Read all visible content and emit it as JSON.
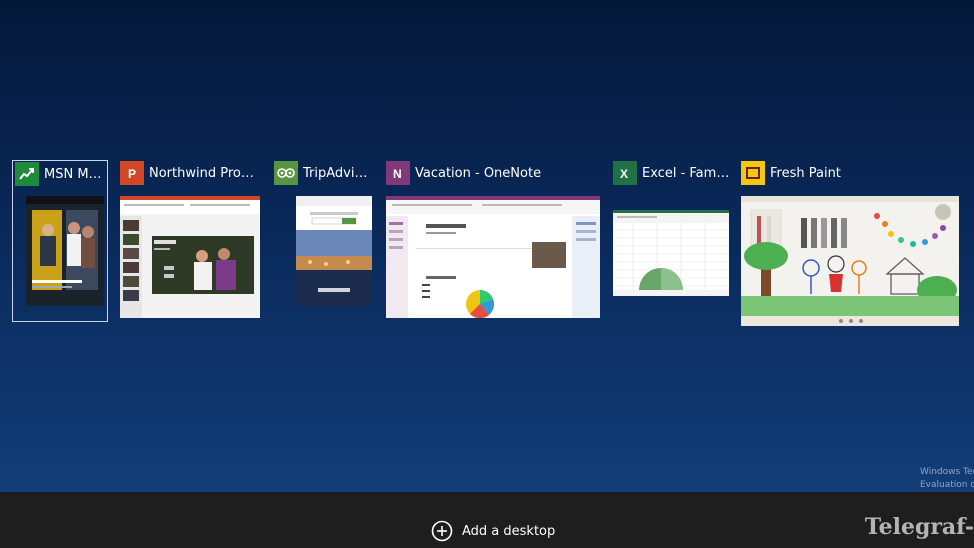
{
  "windows": [
    {
      "title": "MSN Mon...",
      "icon": "msn-money-icon",
      "icon_color": "#1e8a3c"
    },
    {
      "title": "Northwind Proposa...",
      "icon": "powerpoint-icon",
      "icon_color": "#d24726"
    },
    {
      "title": "TripAdvisor...",
      "icon": "tripadvisor-icon",
      "icon_color": "#589442"
    },
    {
      "title": "Vacation - OneNote",
      "icon": "onenote-icon",
      "icon_color": "#80397b"
    },
    {
      "title": "Excel - Family...",
      "icon": "excel-icon",
      "icon_color": "#207245"
    },
    {
      "title": "Fresh Paint",
      "icon": "fresh-paint-icon",
      "icon_color": "#f2c811"
    }
  ],
  "bottom_bar": {
    "add_desktop_label": "Add a desktop",
    "add_icon": "plus-circle-icon"
  },
  "watermark": {
    "eval_line1": "Windows Tec",
    "eval_line2": "Evaluation co",
    "brand": "Telegraf-"
  },
  "colors": {
    "background_top": "#04183a",
    "background_bottom": "#15427e",
    "bar": "#1e1e1e"
  }
}
